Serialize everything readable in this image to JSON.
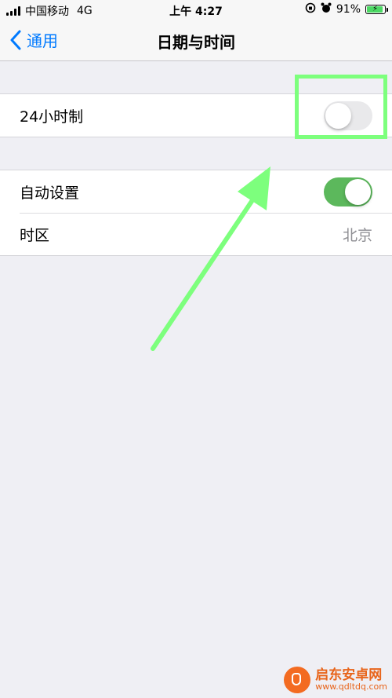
{
  "status_bar": {
    "carrier": "中国移动",
    "network": "4G",
    "time": "上午 4:27",
    "battery_percent": "91%"
  },
  "nav": {
    "back_label": "通用",
    "title": "日期与时间"
  },
  "settings": {
    "group1": [
      {
        "label": "24小时制",
        "toggle": "off"
      }
    ],
    "group2": [
      {
        "label": "自动设置",
        "toggle": "on"
      },
      {
        "label": "时区",
        "value": "北京"
      }
    ]
  },
  "annotation": {
    "highlight_color": "#7dff7d"
  },
  "watermark": {
    "name": "启东安卓网",
    "url": "www.qdltdq.com"
  },
  "colors": {
    "accent": "#007aff",
    "toggle_on": "#5cb85c",
    "toggle_off": "#e9e9eb",
    "background": "#efeff4"
  }
}
